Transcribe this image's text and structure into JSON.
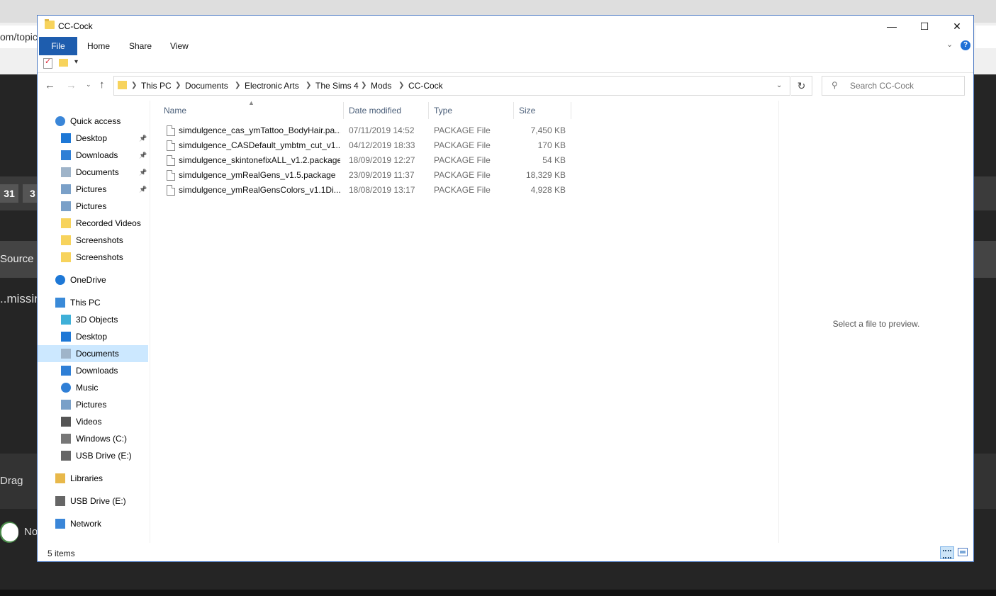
{
  "background": {
    "url_fragment": "om/topic/",
    "badge1": "31",
    "badge2": "3",
    "source_label": "Source",
    "missing_label": "..missin",
    "drag_label": "Drag",
    "toggle_label": "No"
  },
  "window": {
    "title": "CC-Cock",
    "controls": {
      "minimize": "—",
      "maximize": "☐",
      "close": "✕"
    }
  },
  "ribbon": {
    "tabs": [
      "File",
      "Home",
      "Share",
      "View"
    ],
    "help": "?"
  },
  "navigation": {
    "back": "←",
    "forward": "→",
    "recent": "⌄",
    "up": "↑",
    "breadcrumbs": [
      "This PC",
      "Documents",
      "Electronic Arts",
      "The Sims 4",
      "Mods",
      "CC-Cock"
    ],
    "refresh": "↻"
  },
  "search": {
    "placeholder": "Search CC-Cock"
  },
  "sidebar": {
    "items": [
      {
        "label": "Quick access",
        "icon": "star-icon",
        "level": 0
      },
      {
        "label": "Desktop",
        "icon": "desktop-icon",
        "level": 1,
        "pinned": true
      },
      {
        "label": "Downloads",
        "icon": "downloads-icon",
        "level": 1,
        "pinned": true
      },
      {
        "label": "Documents",
        "icon": "documents-icon",
        "level": 1,
        "pinned": true
      },
      {
        "label": "Pictures",
        "icon": "pictures-icon",
        "level": 1,
        "pinned": true
      },
      {
        "label": "Pictures",
        "icon": "pictures-icon",
        "level": 1
      },
      {
        "label": "Recorded Videos",
        "icon": "folder-icon",
        "level": 1
      },
      {
        "label": "Screenshots",
        "icon": "folder-icon",
        "level": 1
      },
      {
        "label": "Screenshots",
        "icon": "folder-icon",
        "level": 1
      },
      {
        "label": "OneDrive",
        "icon": "cloud-icon",
        "level": 0
      },
      {
        "label": "This PC",
        "icon": "computer-icon",
        "level": 0
      },
      {
        "label": "3D Objects",
        "icon": "cube-icon",
        "level": 1
      },
      {
        "label": "Desktop",
        "icon": "desktop-icon",
        "level": 1
      },
      {
        "label": "Documents",
        "icon": "documents-icon",
        "level": 1,
        "selected": true
      },
      {
        "label": "Downloads",
        "icon": "downloads-icon",
        "level": 1
      },
      {
        "label": "Music",
        "icon": "music-icon",
        "level": 1
      },
      {
        "label": "Pictures",
        "icon": "pictures-icon",
        "level": 1
      },
      {
        "label": "Videos",
        "icon": "videos-icon",
        "level": 1
      },
      {
        "label": "Windows (C:)",
        "icon": "drive-icon",
        "level": 1
      },
      {
        "label": "USB Drive (E:)",
        "icon": "usb-drive-icon",
        "level": 1
      },
      {
        "label": "Libraries",
        "icon": "libraries-icon",
        "level": 0
      },
      {
        "label": "USB Drive (E:)",
        "icon": "usb-drive-icon",
        "level": 0
      },
      {
        "label": "Network",
        "icon": "network-icon",
        "level": 0
      }
    ]
  },
  "file_list": {
    "columns": [
      "Name",
      "Date modified",
      "Type",
      "Size"
    ],
    "rows": [
      {
        "name": "simdulgence_cas_ymTattoo_BodyHair.pa...",
        "date": "07/11/2019 14:52",
        "type": "PACKAGE File",
        "size": "7,450 KB"
      },
      {
        "name": "simdulgence_CASDefault_ymbtm_cut_v1...",
        "date": "04/12/2019 18:33",
        "type": "PACKAGE File",
        "size": "170 KB"
      },
      {
        "name": "simdulgence_skintonefixALL_v1.2.package",
        "date": "18/09/2019 12:27",
        "type": "PACKAGE File",
        "size": "54 KB"
      },
      {
        "name": "simdulgence_ymRealGens_v1.5.package",
        "date": "23/09/2019 11:37",
        "type": "PACKAGE File",
        "size": "18,329 KB"
      },
      {
        "name": "simdulgence_ymRealGensColors_v1.1Di...",
        "date": "18/08/2019 13:17",
        "type": "PACKAGE File",
        "size": "4,928 KB"
      }
    ]
  },
  "preview": {
    "message": "Select a file to preview."
  },
  "status": {
    "item_count": "5 items"
  },
  "colors": {
    "accent": "#1e5dae",
    "selection": "#cce8ff",
    "header_text": "#4c607a"
  }
}
